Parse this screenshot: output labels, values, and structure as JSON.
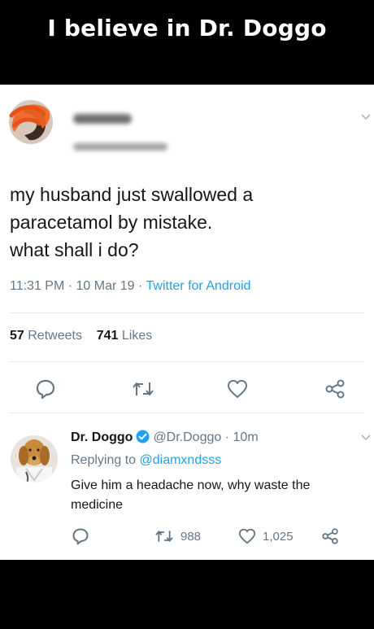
{
  "banner": {
    "title": "I believe in Dr. Doggo"
  },
  "tweet": {
    "text": "my husband just swallowed a\nparacetamol by mistake.\nwhat shall i do?",
    "time": "11:31 PM",
    "date": "10 Mar 19",
    "app": "Twitter for Android",
    "retweets": "57",
    "retweets_label": "Retweets",
    "likes": "741",
    "likes_label": "Likes"
  },
  "reply": {
    "name": "Dr. Doggo",
    "handle": "@Dr.Doggo",
    "age": "10m",
    "replying_to_label": "Replying to",
    "replying_to_handle": "@diamxndsss",
    "text": "Give him a headache now, why waste the medicine",
    "retweets": "988",
    "likes": "1,025"
  },
  "colors": {
    "link_blue": "#1da1f2",
    "secondary_gray": "#657786",
    "verified_blue": "#1da1f2",
    "avatar_scribble": "#f26522"
  },
  "icons": [
    "chevron-down-icon",
    "reply-icon",
    "retweet-icon",
    "like-icon",
    "share-icon",
    "verified-badge-icon"
  ]
}
